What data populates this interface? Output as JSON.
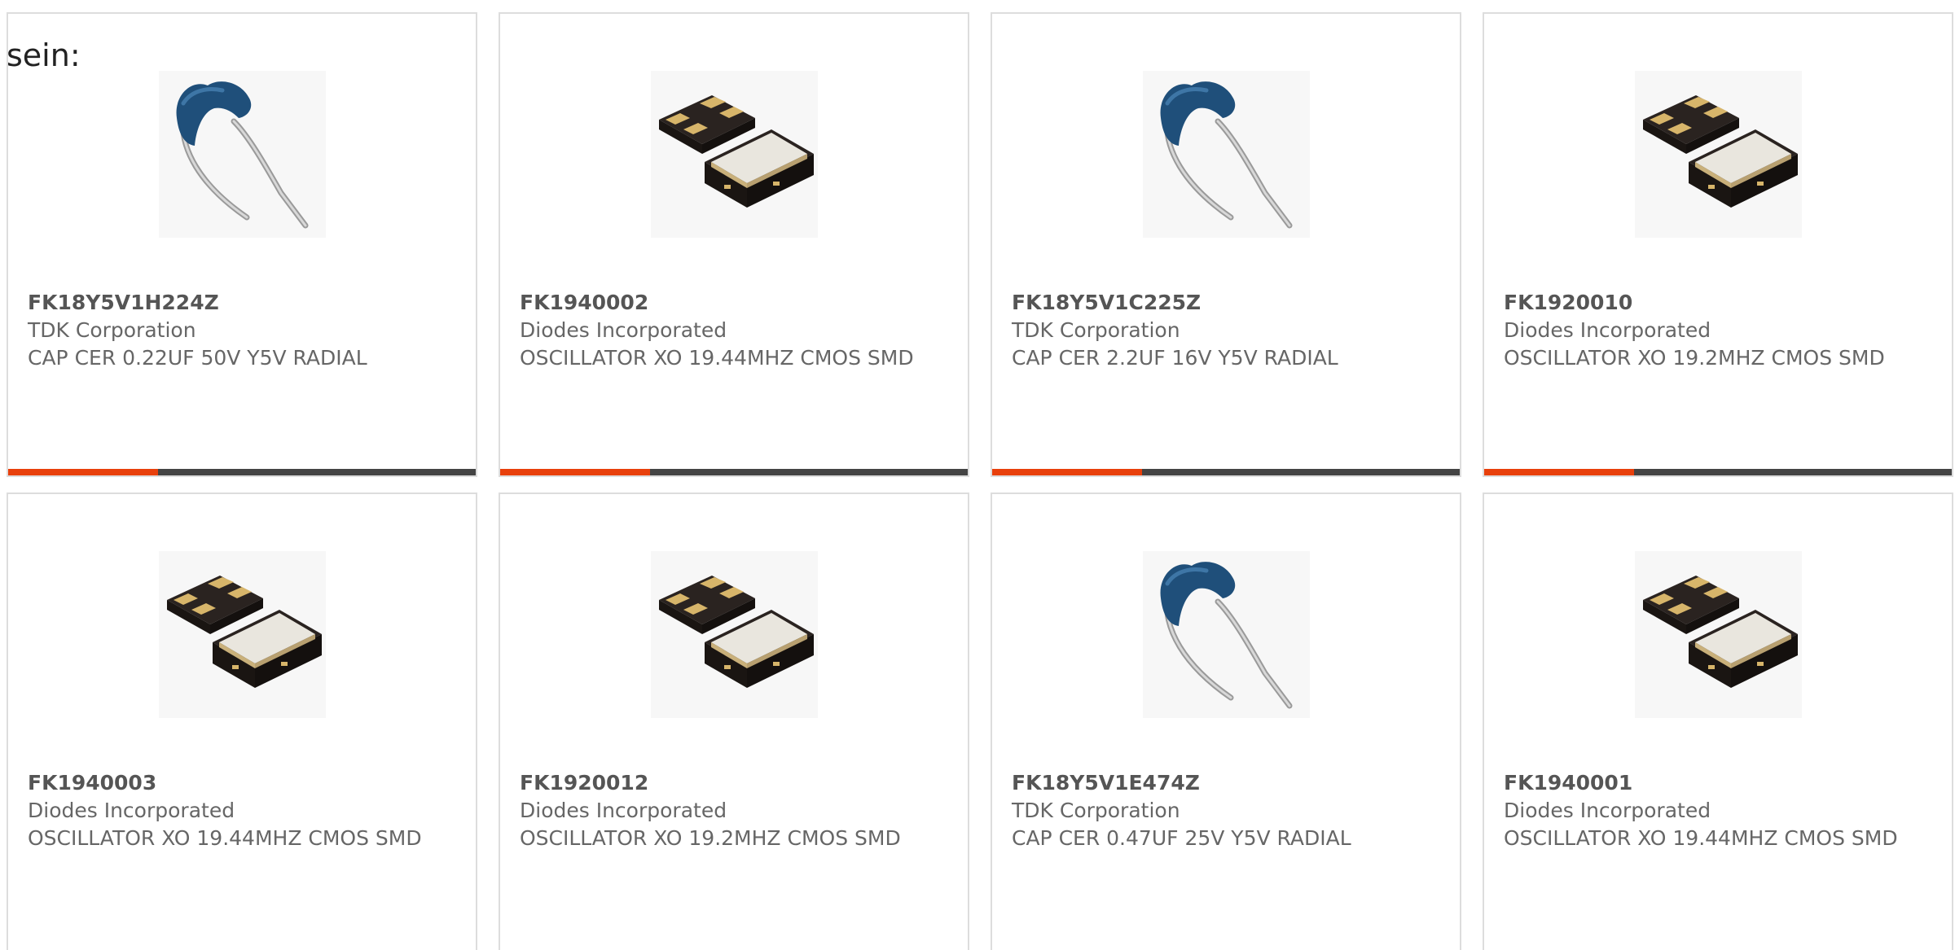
{
  "intro_text": "sein:",
  "colors": {
    "progress_fill": "#e8400c",
    "progress_track": "#444444",
    "card_border": "#dddddd"
  },
  "cards": [
    {
      "part_number": "FK18Y5V1H224Z",
      "manufacturer": "TDK Corporation",
      "description": "CAP CER 0.22UF 50V Y5V RADIAL",
      "image": "radial-capacitor-image",
      "progress": 0.32
    },
    {
      "part_number": "FK1940002",
      "manufacturer": "Diodes Incorporated",
      "description": "OSCILLATOR XO 19.44MHZ CMOS SMD",
      "image": "smd-oscillator-image",
      "progress": 0.32
    },
    {
      "part_number": "FK18Y5V1C225Z",
      "manufacturer": "TDK Corporation",
      "description": "CAP CER 2.2UF 16V Y5V RADIAL",
      "image": "radial-capacitor-image",
      "progress": 0.32
    },
    {
      "part_number": "FK1920010",
      "manufacturer": "Diodes Incorporated",
      "description": "OSCILLATOR XO 19.2MHZ CMOS SMD",
      "image": "smd-oscillator-image",
      "progress": 0.32
    },
    {
      "part_number": "FK1940003",
      "manufacturer": "Diodes Incorporated",
      "description": "OSCILLATOR XO 19.44MHZ CMOS SMD",
      "image": "smd-oscillator-image"
    },
    {
      "part_number": "FK1920012",
      "manufacturer": "Diodes Incorporated",
      "description": "OSCILLATOR XO 19.2MHZ CMOS SMD",
      "image": "smd-oscillator-image"
    },
    {
      "part_number": "FK18Y5V1E474Z",
      "manufacturer": "TDK Corporation",
      "description": "CAP CER 0.47UF 25V Y5V RADIAL",
      "image": "radial-capacitor-image"
    },
    {
      "part_number": "FK1940001",
      "manufacturer": "Diodes Incorporated",
      "description": "OSCILLATOR XO 19.44MHZ CMOS SMD",
      "image": "smd-oscillator-image"
    }
  ]
}
